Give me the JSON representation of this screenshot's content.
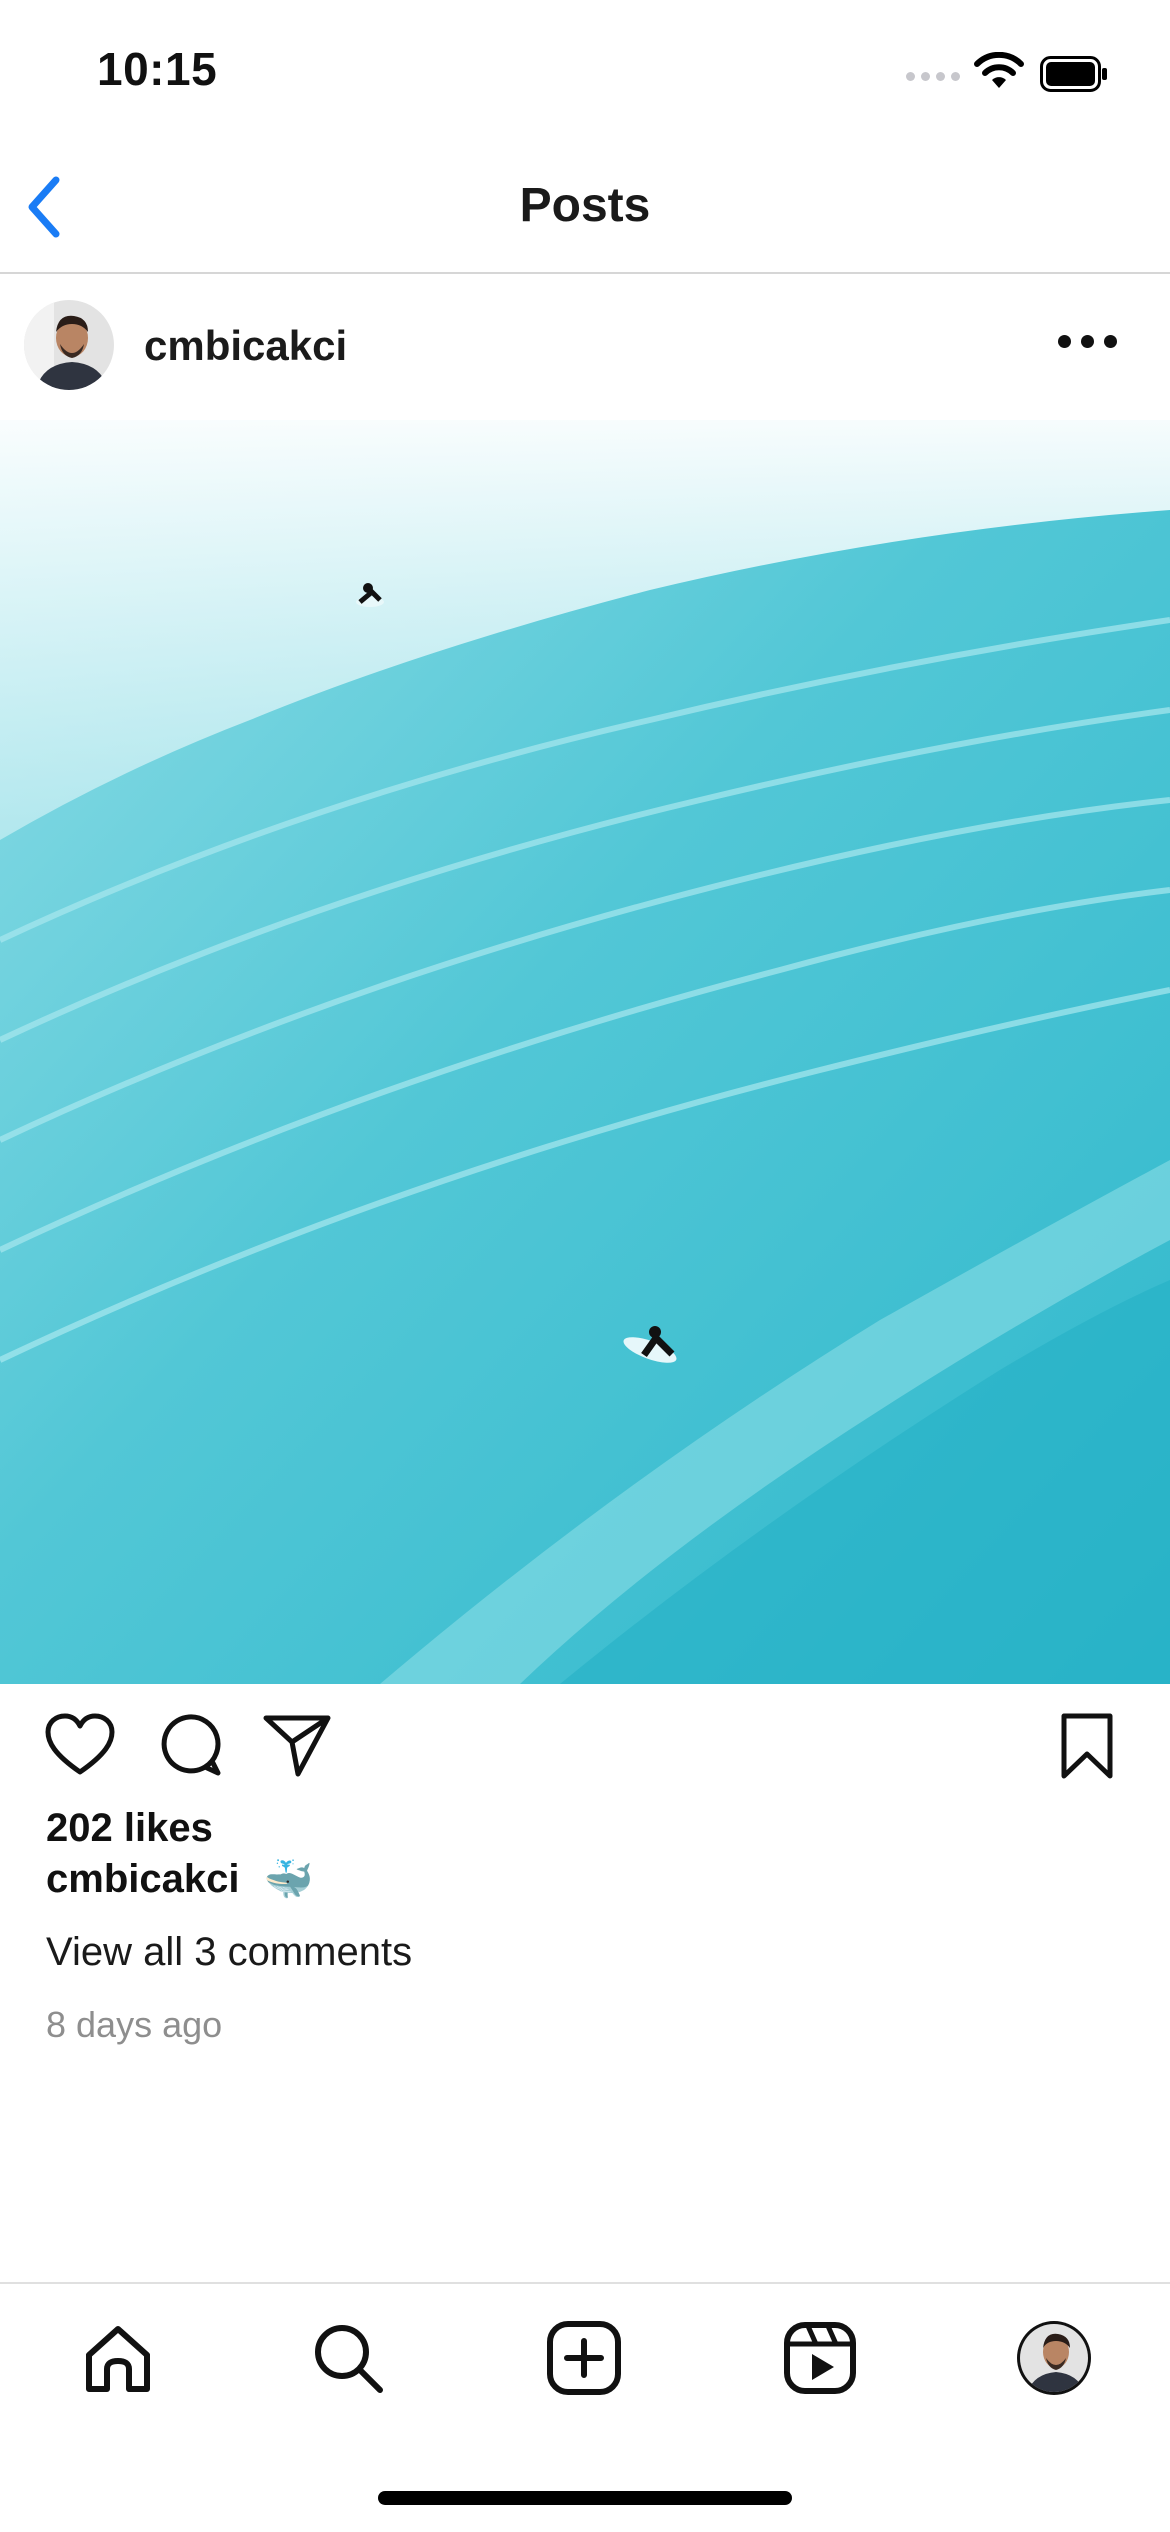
{
  "status_bar": {
    "time": "10:15",
    "signal_icon": "cellular-signal-icon",
    "wifi_icon": "wifi-icon",
    "battery_icon": "battery-icon"
  },
  "header": {
    "back_icon": "chevron-left-icon",
    "title": "Posts",
    "accent_color": "#1a7cf5"
  },
  "post": {
    "username": "cmbicakci",
    "more_icon": "more-horizontal-icon",
    "photo_description_icon": "ocean-surf-photo",
    "actions": {
      "like_icon": "heart-icon",
      "comment_icon": "comment-icon",
      "share_icon": "paper-plane-icon",
      "save_icon": "bookmark-icon"
    },
    "likes": "202 likes",
    "caption_user": "cmbicakci",
    "caption_text": "🐳",
    "view_comments": "View all 3 comments",
    "time_ago": "8 days ago"
  },
  "tab_bar": {
    "items": [
      {
        "icon": "home-icon"
      },
      {
        "icon": "search-icon"
      },
      {
        "icon": "add-post-icon"
      },
      {
        "icon": "reels-icon"
      },
      {
        "icon": "profile-avatar"
      }
    ]
  }
}
